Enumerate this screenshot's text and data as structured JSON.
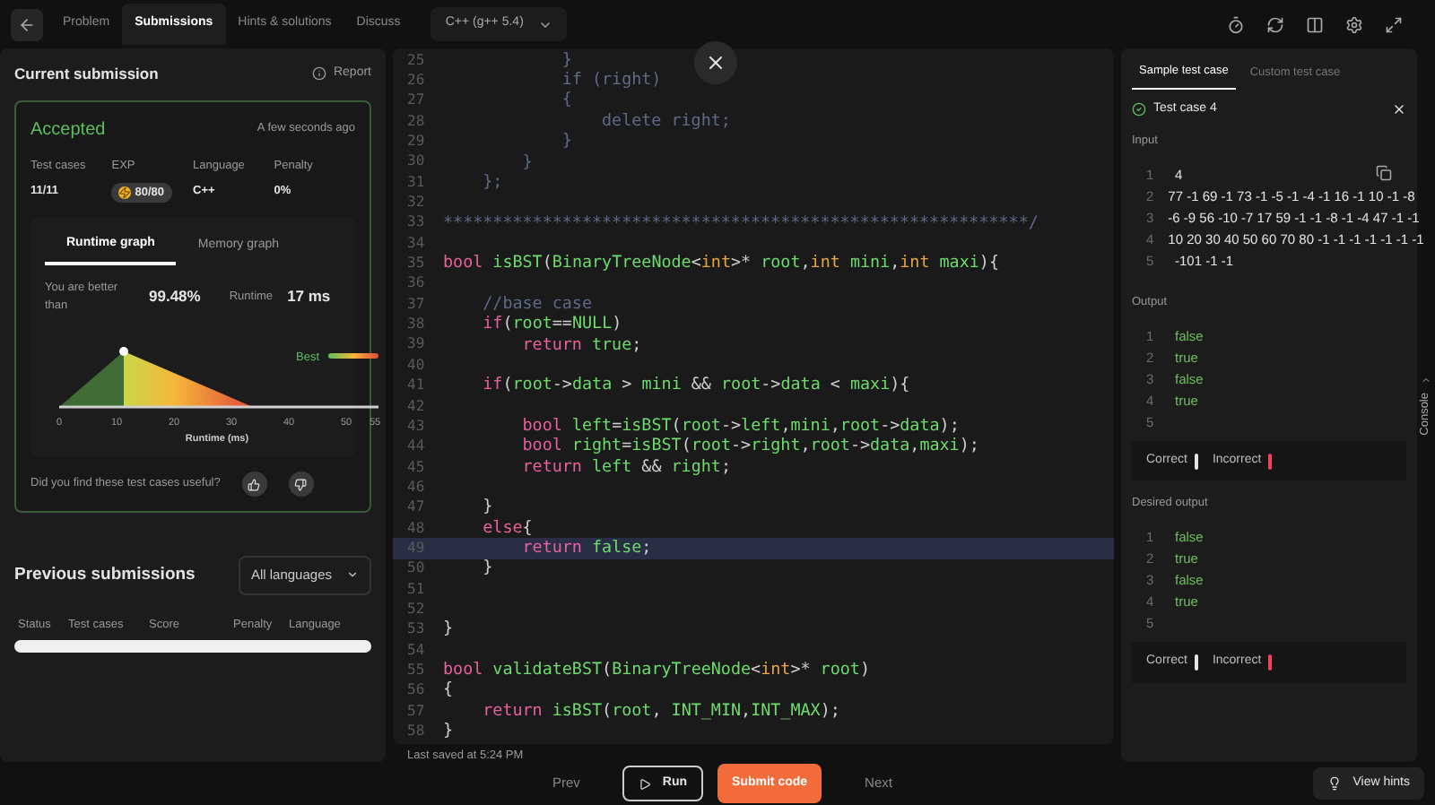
{
  "top_bar": {
    "tabs": [
      {
        "label": "Problem",
        "selected": false
      },
      {
        "label": "Submissions",
        "selected": true
      },
      {
        "label": "Hints & solutions",
        "selected": false
      },
      {
        "label": "Discuss",
        "selected": false
      }
    ],
    "language_select": "C++ (g++ 5.4)"
  },
  "current_submission": {
    "title": "Current submission",
    "report": "Report",
    "status": "Accepted",
    "time": "A few seconds ago",
    "stats": [
      {
        "label": "Test cases",
        "value": "11/11",
        "kind": "plain"
      },
      {
        "label": "EXP",
        "value": "80/80",
        "kind": "badge"
      },
      {
        "label": "Language",
        "value": "C++",
        "kind": "plain"
      },
      {
        "label": "Penalty",
        "value": "0%",
        "kind": "plain"
      }
    ],
    "graph_tabs": [
      {
        "label": "Runtime graph",
        "selected": true
      },
      {
        "label": "Memory graph",
        "selected": false
      }
    ],
    "better_than_label": "You are better than",
    "better_than_value": "99.48%",
    "runtime_label": "Runtime",
    "runtime_value": "17 ms",
    "graph": {
      "legend": "Best",
      "xticks": [
        "0",
        "10",
        "20",
        "30",
        "40",
        "50",
        "55"
      ],
      "xlabel": "Runtime (ms)"
    },
    "feedback_question": "Did you find these test cases useful?"
  },
  "previous_submissions": {
    "title": "Previous submissions",
    "filter": "All languages",
    "columns": [
      "Status",
      "Test cases",
      "Score",
      "Penalty",
      "Language"
    ]
  },
  "code": {
    "lines": [
      {
        "n": "25",
        "current": false,
        "tokens": [
          {
            "kind": "dim",
            "text": "            }"
          }
        ]
      },
      {
        "n": "26",
        "current": false,
        "tokens": [
          {
            "kind": "dim",
            "text": "            if (right)"
          }
        ]
      },
      {
        "n": "27",
        "current": false,
        "tokens": [
          {
            "kind": "dim",
            "text": "            {"
          }
        ]
      },
      {
        "n": "28",
        "current": false,
        "tokens": [
          {
            "kind": "dim",
            "text": "                delete right;"
          }
        ]
      },
      {
        "n": "29",
        "current": false,
        "tokens": [
          {
            "kind": "dim",
            "text": "            }"
          }
        ]
      },
      {
        "n": "30",
        "current": false,
        "tokens": [
          {
            "kind": "dim",
            "text": "        }"
          }
        ]
      },
      {
        "n": "31",
        "current": false,
        "tokens": [
          {
            "kind": "dim",
            "text": "    };"
          }
        ]
      },
      {
        "n": "32",
        "current": false
      },
      {
        "n": "33",
        "current": false,
        "tokens": [
          {
            "kind": "dim",
            "text": "***********************************************************/"
          }
        ]
      },
      {
        "n": "34",
        "current": false
      },
      {
        "n": "35",
        "current": false,
        "tokens": [
          {
            "kind": "kw",
            "text": "bool "
          },
          {
            "kind": "fn",
            "text": "isBST"
          },
          {
            "kind": "p",
            "text": "("
          },
          {
            "kind": "fn",
            "text": "BinaryTreeNode"
          },
          {
            "kind": "p",
            "text": "<"
          },
          {
            "kind": "type",
            "text": "int"
          },
          {
            "kind": "p",
            "text": ">* "
          },
          {
            "kind": "fn",
            "text": "root"
          },
          {
            "kind": "p",
            "text": ","
          },
          {
            "kind": "type",
            "text": "int "
          },
          {
            "kind": "fn",
            "text": "mini"
          },
          {
            "kind": "p",
            "text": ","
          },
          {
            "kind": "type",
            "text": "int "
          },
          {
            "kind": "fn",
            "text": "maxi"
          },
          {
            "kind": "p",
            "text": "){"
          }
        ]
      },
      {
        "n": "36",
        "current": false
      },
      {
        "n": "37",
        "current": false,
        "tokens": [
          {
            "kind": "dim",
            "text": "    //base case"
          }
        ]
      },
      {
        "n": "38",
        "current": false,
        "tokens": [
          {
            "kind": "kw",
            "text": "    if"
          },
          {
            "kind": "p",
            "text": "("
          },
          {
            "kind": "fn",
            "text": "root"
          },
          {
            "kind": "p",
            "text": "=="
          },
          {
            "kind": "fn",
            "text": "NULL"
          },
          {
            "kind": "p",
            "text": ")"
          }
        ]
      },
      {
        "n": "39",
        "current": false,
        "tokens": [
          {
            "kind": "kw",
            "text": "        return "
          },
          {
            "kind": "fn",
            "text": "true"
          },
          {
            "kind": "p",
            "text": ";"
          }
        ]
      },
      {
        "n": "40",
        "current": false
      },
      {
        "n": "41",
        "current": false,
        "tokens": [
          {
            "kind": "kw",
            "text": "    if"
          },
          {
            "kind": "p",
            "text": "("
          },
          {
            "kind": "fn",
            "text": "root"
          },
          {
            "kind": "p",
            "text": "->"
          },
          {
            "kind": "fn",
            "text": "data"
          },
          {
            "kind": "p",
            "text": " > "
          },
          {
            "kind": "fn",
            "text": "mini"
          },
          {
            "kind": "p",
            "text": " && "
          },
          {
            "kind": "fn",
            "text": "root"
          },
          {
            "kind": "p",
            "text": "->"
          },
          {
            "kind": "fn",
            "text": "data"
          },
          {
            "kind": "p",
            "text": " < "
          },
          {
            "kind": "fn",
            "text": "maxi"
          },
          {
            "kind": "p",
            "text": "){"
          }
        ]
      },
      {
        "n": "42",
        "current": false
      },
      {
        "n": "43",
        "current": false,
        "tokens": [
          {
            "kind": "kw",
            "text": "        bool "
          },
          {
            "kind": "fn",
            "text": "left"
          },
          {
            "kind": "p",
            "text": "="
          },
          {
            "kind": "fn",
            "text": "isBST"
          },
          {
            "kind": "p",
            "text": "("
          },
          {
            "kind": "fn",
            "text": "root"
          },
          {
            "kind": "p",
            "text": "->"
          },
          {
            "kind": "fn",
            "text": "left"
          },
          {
            "kind": "p",
            "text": ","
          },
          {
            "kind": "fn",
            "text": "mini"
          },
          {
            "kind": "p",
            "text": ","
          },
          {
            "kind": "fn",
            "text": "root"
          },
          {
            "kind": "p",
            "text": "->"
          },
          {
            "kind": "fn",
            "text": "data"
          },
          {
            "kind": "p",
            "text": ");"
          }
        ]
      },
      {
        "n": "44",
        "current": false,
        "tokens": [
          {
            "kind": "kw",
            "text": "        bool "
          },
          {
            "kind": "fn",
            "text": "right"
          },
          {
            "kind": "p",
            "text": "="
          },
          {
            "kind": "fn",
            "text": "isBST"
          },
          {
            "kind": "p",
            "text": "("
          },
          {
            "kind": "fn",
            "text": "root"
          },
          {
            "kind": "p",
            "text": "->"
          },
          {
            "kind": "fn",
            "text": "right"
          },
          {
            "kind": "p",
            "text": ","
          },
          {
            "kind": "fn",
            "text": "root"
          },
          {
            "kind": "p",
            "text": "->"
          },
          {
            "kind": "fn",
            "text": "data"
          },
          {
            "kind": "p",
            "text": ","
          },
          {
            "kind": "fn",
            "text": "maxi"
          },
          {
            "kind": "p",
            "text": ");"
          }
        ]
      },
      {
        "n": "45",
        "current": false,
        "tokens": [
          {
            "kind": "kw",
            "text": "        return "
          },
          {
            "kind": "fn",
            "text": "left"
          },
          {
            "kind": "p",
            "text": " && "
          },
          {
            "kind": "fn",
            "text": "right"
          },
          {
            "kind": "p",
            "text": ";"
          }
        ]
      },
      {
        "n": "46",
        "current": false
      },
      {
        "n": "47",
        "current": false,
        "tokens": [
          {
            "kind": "p",
            "text": "    }"
          }
        ]
      },
      {
        "n": "48",
        "current": false,
        "tokens": [
          {
            "kind": "kw",
            "text": "    else"
          },
          {
            "kind": "p",
            "text": "{"
          }
        ]
      },
      {
        "n": "49",
        "current": true,
        "tokens": [
          {
            "kind": "kw",
            "text": "        return "
          },
          {
            "kind": "fn",
            "text": "false"
          },
          {
            "kind": "p",
            "text": ";"
          }
        ]
      },
      {
        "n": "50",
        "current": false,
        "tokens": [
          {
            "kind": "p",
            "text": "    }"
          }
        ]
      },
      {
        "n": "51",
        "current": false
      },
      {
        "n": "52",
        "current": false
      },
      {
        "n": "53",
        "current": false,
        "tokens": [
          {
            "kind": "p",
            "text": "}"
          }
        ]
      },
      {
        "n": "54",
        "current": false
      },
      {
        "n": "55",
        "current": false,
        "tokens": [
          {
            "kind": "kw",
            "text": "bool "
          },
          {
            "kind": "fn",
            "text": "validateBST"
          },
          {
            "kind": "p",
            "text": "("
          },
          {
            "kind": "fn",
            "text": "BinaryTreeNode"
          },
          {
            "kind": "p",
            "text": "<"
          },
          {
            "kind": "type",
            "text": "int"
          },
          {
            "kind": "p",
            "text": ">* "
          },
          {
            "kind": "fn",
            "text": "root"
          },
          {
            "kind": "p",
            "text": ")"
          }
        ]
      },
      {
        "n": "56",
        "current": false,
        "tokens": [
          {
            "kind": "p",
            "text": "{"
          }
        ]
      },
      {
        "n": "57",
        "current": false,
        "tokens": [
          {
            "kind": "kw",
            "text": "    return "
          },
          {
            "kind": "fn",
            "text": "isBST"
          },
          {
            "kind": "p",
            "text": "("
          },
          {
            "kind": "fn",
            "text": "root"
          },
          {
            "kind": "p",
            "text": ", "
          },
          {
            "kind": "fn",
            "text": "INT_MIN"
          },
          {
            "kind": "p",
            "text": ","
          },
          {
            "kind": "fn",
            "text": "INT_MAX"
          },
          {
            "kind": "p",
            "text": ");"
          }
        ]
      },
      {
        "n": "58",
        "current": false,
        "tokens": [
          {
            "kind": "p",
            "text": "}"
          }
        ]
      }
    ],
    "last_saved": "Last saved at 5:24 PM"
  },
  "test_panel": {
    "tabs": [
      {
        "label": "Sample test case",
        "selected": true
      },
      {
        "label": "Custom test case",
        "selected": false
      }
    ],
    "case_title": "Test case 4",
    "input_label": "Input",
    "input": [
      {
        "n": "1",
        "text": "4"
      },
      {
        "n": "2",
        "text": "77 -1 69 -1 73 -1 -5 -1 -4 -1 16 -1 10 -1 -8"
      },
      {
        "n": "3",
        "text": "-6 -9 56 -10 -7 17 59 -1 -1 -8 -1 -4 47 -1 -1"
      },
      {
        "n": "4",
        "text": "10 20 30 40 50 60 70 80 -1 -1 -1 -1 -1 -1 -1"
      },
      {
        "n": "5",
        "text": "-101 -1 -1"
      }
    ],
    "output_label": "Output",
    "output": [
      {
        "n": "1",
        "text": "false"
      },
      {
        "n": "2",
        "text": "true"
      },
      {
        "n": "3",
        "text": "false"
      },
      {
        "n": "4",
        "text": "true"
      },
      {
        "n": "5"
      }
    ],
    "output_legend": [
      {
        "label": "Correct",
        "color": "#e5e5e5"
      },
      {
        "label": "Incorrect",
        "color": "#f43f5e"
      }
    ],
    "desired_label": "Desired output",
    "desired": [
      {
        "n": "1",
        "text": "false"
      },
      {
        "n": "2",
        "text": "true"
      },
      {
        "n": "3",
        "text": "false"
      },
      {
        "n": "4",
        "text": "true"
      },
      {
        "n": "5"
      }
    ],
    "desired_legend": [
      {
        "label": "Correct",
        "color": "#e5e5e5"
      },
      {
        "label": "Incorrect",
        "color": "#f43f5e"
      }
    ]
  },
  "console_label": "Console",
  "bottom_bar": {
    "prev": "Prev",
    "run": "Run",
    "submit": "Submit code",
    "next": "Next",
    "hints": "View hints"
  }
}
